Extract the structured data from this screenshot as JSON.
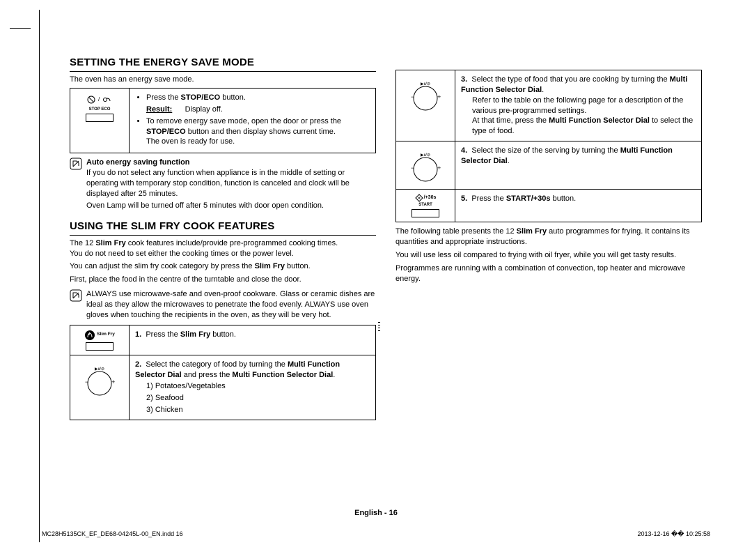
{
  "section1": {
    "heading": "SETTING THE ENERGY SAVE MODE",
    "intro": "The oven has an energy save mode.",
    "iconLabel": "STOP  ECO",
    "bullet1_a": "Press the ",
    "bullet1_b": "STOP/ECO",
    "bullet1_c": " button.",
    "resultLabel": "Result:",
    "resultText": "Display off.",
    "bullet2_a": "To remove energy save mode, open the door or press the ",
    "bullet2_b": "STOP/ECO",
    "bullet2_c": " button and then display shows current time.",
    "bullet2_d": "The oven is ready for use.",
    "noteTitle": "Auto energy saving function",
    "noteBody1": "If you do not select any function when appliance is in the middle of setting or operating with temporary stop condition, function is canceled and clock will be displayed after 25 minutes.",
    "noteBody2": "Oven Lamp will be turned off after 5 minutes with door open condition."
  },
  "section2": {
    "heading": "USING THE SLIM FRY COOK FEATURES",
    "intro1_a": "The 12 ",
    "intro1_b": "Slim Fry",
    "intro1_c": " cook features include/provide pre-programmed cooking times.",
    "intro1_d": "You do not need to set either the cooking times or the power level.",
    "intro2_a": "You can adjust the slim fry cook category by press the ",
    "intro2_b": "Slim Fry",
    "intro2_c": " button.",
    "intro3": "First, place the food in the centre of the turntable and close the door.",
    "note": "ALWAYS use microwave-safe and oven-proof cookware. Glass or ceramic dishes are ideal as they allow the microwaves to penetrate the food evenly. ALWAYS use oven gloves when touching the recipients in the oven, as they will be very hot.",
    "step1Icon": "Slim Fry",
    "step1_a": "Press the ",
    "step1_b": "Slim Fry",
    "step1_c": " button.",
    "step2_a": "Select the category of food by turning the ",
    "step2_b": "Multi Function Selector Dial",
    "step2_c": " and press the ",
    "step2_d": "Multi Function Selector Dial",
    "step2_e": ".",
    "cat1": "1) Potatoes/Vegetables",
    "cat2": "2) Seafood",
    "cat3": "3) Chicken"
  },
  "section3": {
    "step3_a": "Select the type of food that you are cooking by turning the ",
    "step3_b": "Multi Function Selector Dial",
    "step3_c": ".",
    "step3_d": "Refer to the table on the following page for a description of the various pre-programmed settings.",
    "step3_e": "At that time, press the ",
    "step3_f": "Multi Function Selector Dial",
    "step3_g": " to select the type of food.",
    "step4_a": "Select the size of the serving by turning the ",
    "step4_b": "Multi Function Selector Dial",
    "step4_c": ".",
    "step5Icon": "/+30s",
    "step5Start": "START",
    "step5_a": "Press the ",
    "step5_b": "START/+30s",
    "step5_c": " button.",
    "para1_a": "The following table presents the 12 ",
    "para1_b": "Slim Fry",
    "para1_c": " auto programmes for frying. It contains its quantities and appropriate instructions.",
    "para2": "You will use less oil compared to frying with oil fryer, while you will get tasty results.",
    "para3": "Programmes are running with a combination of convection, top heater and microwave energy."
  },
  "footer": {
    "page": "English - 16",
    "indd": "MC28H5135CK_EF_DE68-04245L-00_EN.indd   16",
    "date": "2013-12-16   �� 10:25:58"
  }
}
